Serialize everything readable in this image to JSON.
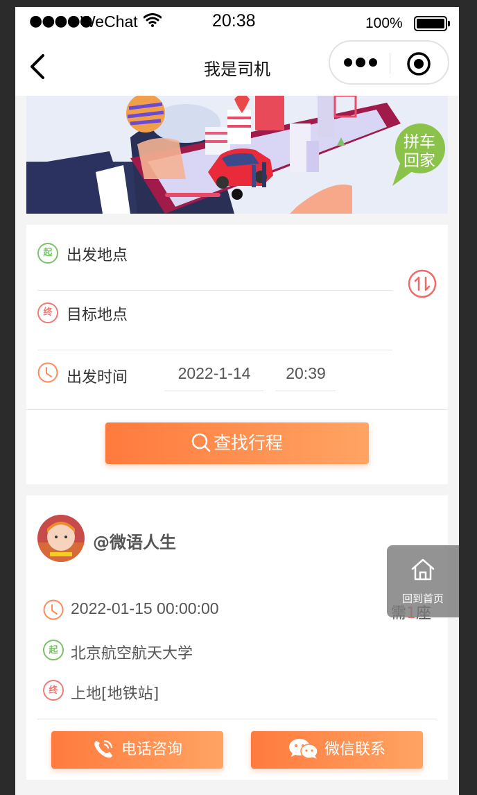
{
  "status_bar": {
    "signal": "●●●●●",
    "carrier": "WeChat",
    "time": "20:38",
    "battery": "100%"
  },
  "navbar": {
    "title": "我是司机"
  },
  "banner": {
    "badge_line1": "拼车",
    "badge_line2": "回家"
  },
  "search": {
    "start_badge": "起",
    "start_label": "出发地点",
    "end_badge": "终",
    "end_label": "目标地点",
    "time_label": "出发时间",
    "date_value": "2022-1-14",
    "time_value": "20:39",
    "search_button": "查找行程"
  },
  "trip": {
    "username": "@微语人生",
    "datetime": "2022-01-15 00:00:00",
    "start_badge": "起",
    "start": "北京航空航天大学",
    "end_badge": "终",
    "end": "上地[地铁站]",
    "seats_prefix": "需",
    "seats_num": "1",
    "seats_suffix": "座",
    "phone_button": "电话咨询",
    "wechat_button": "微信联系"
  },
  "float_home": {
    "label": "回到首页"
  },
  "colors": {
    "accent_orange": "#ff7a3d",
    "start_green": "#7ac36a",
    "end_red": "#f07a74"
  }
}
